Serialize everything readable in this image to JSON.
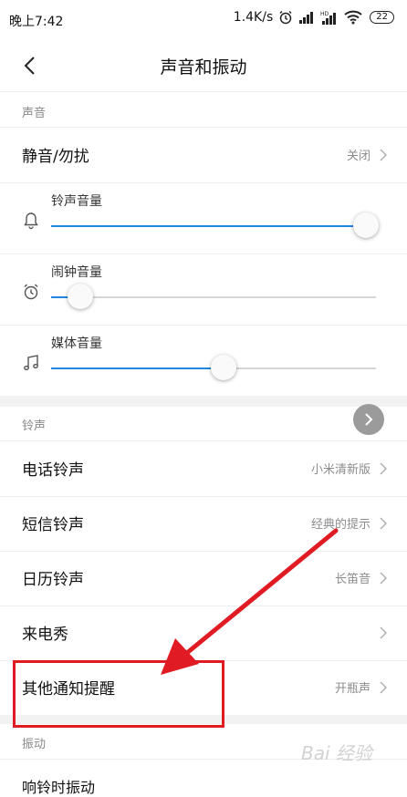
{
  "status_bar": {
    "time": "晚上7:42",
    "net_speed": "1.4K/s",
    "battery": "22",
    "icons": [
      "alarm-icon",
      "signal-icon",
      "signal-hd-icon",
      "wifi-icon",
      "battery-icon"
    ]
  },
  "header": {
    "title": "声音和振动",
    "back_icon": "chevron-left-icon"
  },
  "sections": {
    "sound": {
      "label": "声音",
      "mute_row": {
        "label": "静音/勿扰",
        "value": "关闭"
      },
      "volumes": [
        {
          "label": "铃声音量",
          "icon": "bell-icon",
          "level": 0.97
        },
        {
          "label": "闹钟音量",
          "icon": "alarm-clock-icon",
          "level": 0.09
        },
        {
          "label": "媒体音量",
          "icon": "music-note-icon",
          "level": 0.53
        }
      ]
    },
    "ringtone": {
      "label": "铃声",
      "rows": [
        {
          "label": "电话铃声",
          "value": "小米清新版"
        },
        {
          "label": "短信铃声",
          "value": "经典的提示"
        },
        {
          "label": "日历铃声",
          "value": "长笛音"
        },
        {
          "label": "来电秀",
          "value": ""
        },
        {
          "label": "其他通知提醒",
          "value": "开瓶声"
        }
      ]
    },
    "vibration": {
      "label": "振动",
      "partial_row": "响铃时振动"
    }
  },
  "overlay": {
    "watermark": "Bai 经验",
    "annotation_color": "#e01b23"
  },
  "colors": {
    "accent": "#1e88e5",
    "section_bg": "#f2f2f2",
    "secondary_text": "#8c8c8c"
  }
}
